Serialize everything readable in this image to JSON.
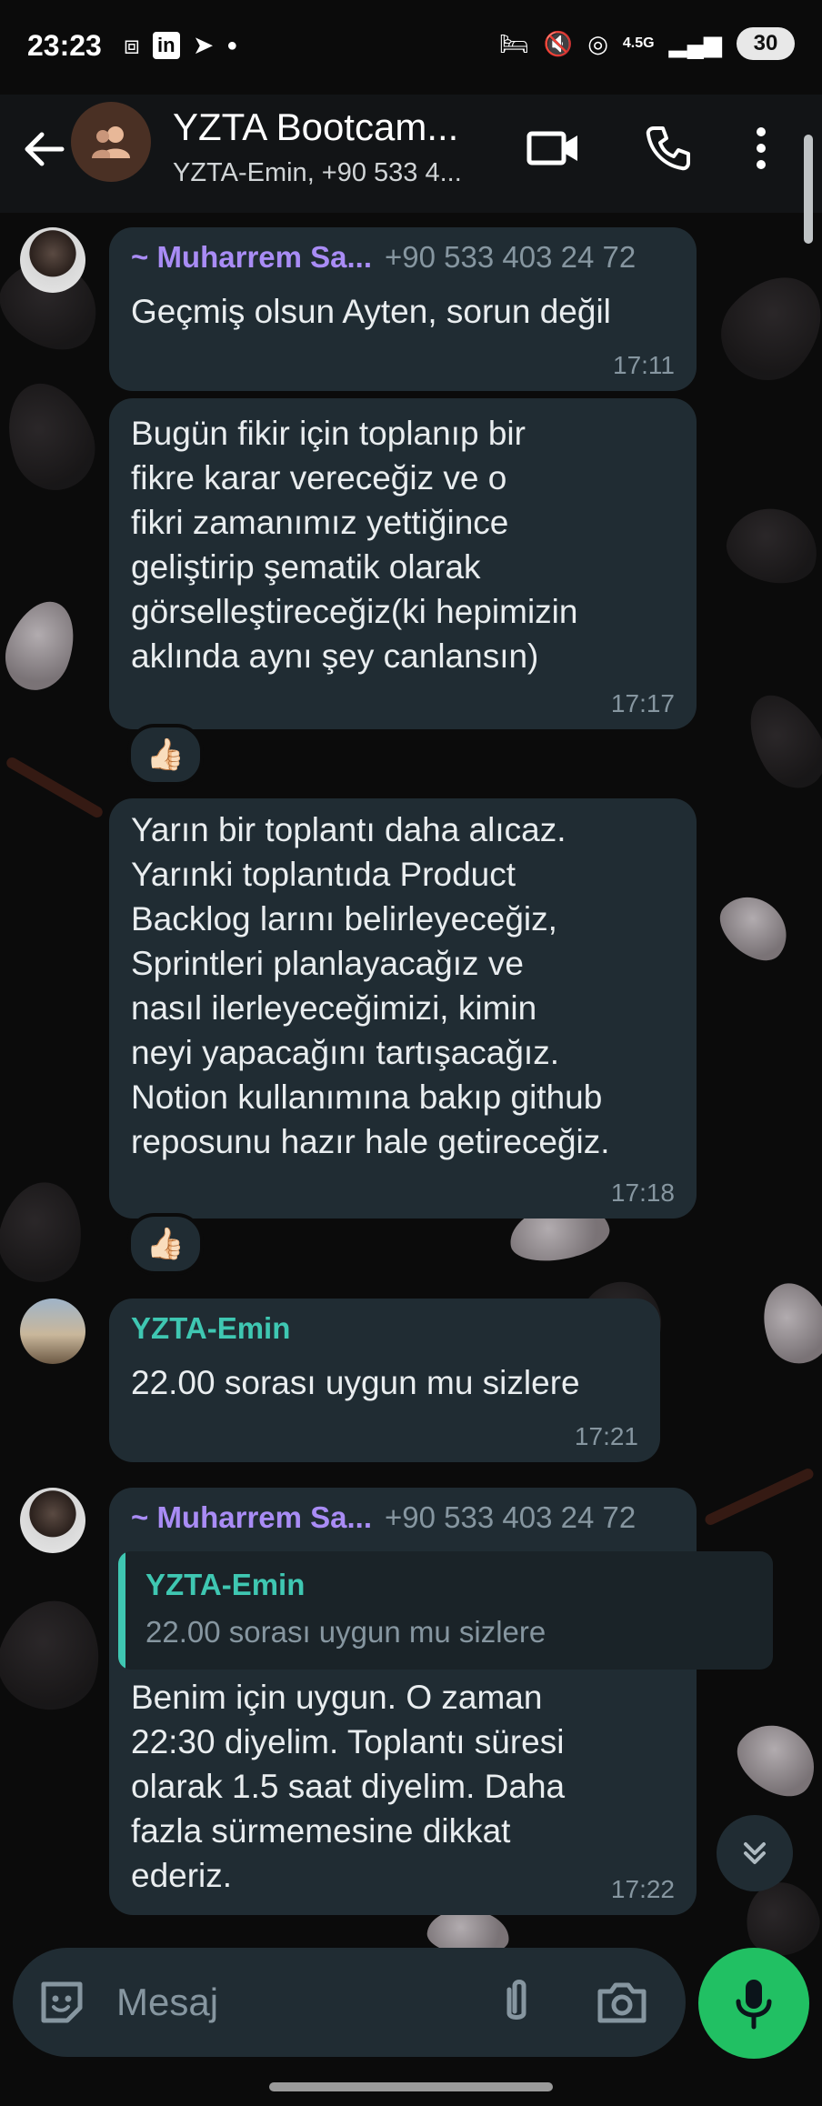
{
  "status_bar": {
    "time": "23:23",
    "network": "4.5G",
    "battery": "30"
  },
  "header": {
    "title": "YZTA Bootcam...",
    "subtitle": "YZTA-Emin, +90 533 4..."
  },
  "messages": [
    {
      "sender": "~ Muharrem Sa...",
      "phone": "+90 533 403 24 72",
      "text": "Geçmiş olsun Ayten, sorun değil",
      "time": "17:11"
    },
    {
      "text": "Bugün fikir için toplanıp bir\nfikre karar vereceğiz ve o\nfikri zamanımız yettiğince\ngeliştirip şematik olarak\ngörselleştireceğiz(ki hepimizin\naklında aynı şey canlansın)",
      "time": "17:17",
      "reaction": "👍🏻"
    },
    {
      "text": "Yarın bir toplantı daha alıcaz.\nYarınki toplantıda Product\nBacklog larını belirleyeceğiz,\nSprintleri planlayacağız ve\nnasıl ilerleyeceğimizi, kimin\nneyi yapacağını tartışacağız.\nNotion kullanımına bakıp github\nreposunu hazır hale getireceğiz.",
      "time": "17:18",
      "reaction": "👍🏻"
    },
    {
      "sender": "YZTA-Emin",
      "text": "22.00 sorası uygun mu sizlere",
      "time": "17:21"
    },
    {
      "sender": "~ Muharrem Sa...",
      "phone": "+90 533 403 24 72",
      "quote_sender": "YZTA-Emin",
      "quote_text": "22.00 sorası uygun mu sizlere",
      "text": "Benim için uygun. O zaman\n22:30 diyelim. Toplantı süresi\nolarak 1.5 saat diyelim. Daha\nfazla sürmemesine dikkat\nederiz.",
      "time": "17:22"
    }
  ],
  "input": {
    "placeholder": "Mesaj"
  },
  "colors": {
    "accent_green": "#21c063",
    "bubble": "#202c33",
    "sender_purple": "#a98cf5",
    "sender_teal": "#3fc7b2"
  },
  "icons": [
    "back-arrow-icon",
    "group-icon",
    "video-call-icon",
    "voice-call-icon",
    "more-options-icon",
    "thumbs-up-icon",
    "scroll-down-icon",
    "sticker-icon",
    "attach-icon",
    "camera-icon",
    "mic-icon"
  ]
}
